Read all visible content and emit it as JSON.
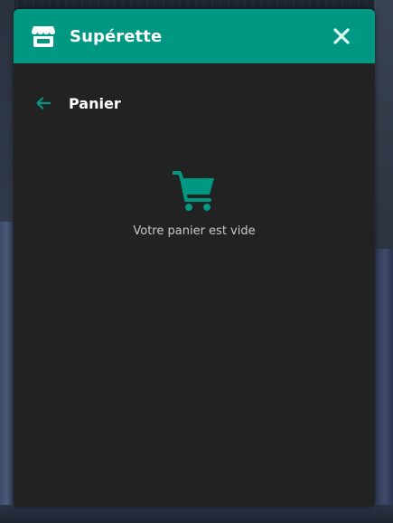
{
  "colors": {
    "accent": "#009882",
    "panel_bg": "#222222",
    "text_primary": "#ffffff",
    "text_secondary": "#c9c9c9"
  },
  "header": {
    "title": "Supérette",
    "icon": "store-icon",
    "close_icon": "close-icon"
  },
  "cart": {
    "title": "Panier",
    "back_icon": "arrow-left-icon",
    "empty_icon": "shopping-cart-icon",
    "empty_message": "Votre panier est vide"
  }
}
